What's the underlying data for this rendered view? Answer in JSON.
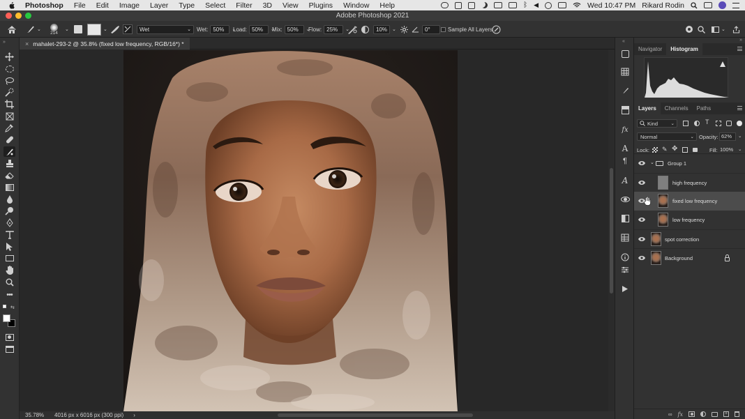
{
  "menubar": {
    "apple": "",
    "app": "Photoshop",
    "items": [
      "File",
      "Edit",
      "Image",
      "Layer",
      "Type",
      "Select",
      "Filter",
      "3D",
      "View",
      "Plugins",
      "Window",
      "Help"
    ],
    "clock": "Wed 10:47 PM",
    "user": "Rikard Rodin"
  },
  "window": {
    "title": "Adobe Photoshop 2021"
  },
  "options_bar": {
    "brush_size": "214",
    "mix_preset": "Wet",
    "wet_label": "Wet:",
    "wet_value": "50%",
    "load_label": "Load:",
    "load_value": "50%",
    "mix_label": "Mix:",
    "mix_value": "50%",
    "flow_label": "Flow:",
    "flow_value": "25%",
    "smoothing_value": "10%",
    "angle_value": "0°",
    "sample_all_layers": "Sample All Layers"
  },
  "document": {
    "tab_title": "mahalet-293-2 @ 35.8% (fixed low frequency, RGB/16*) *",
    "zoom": "35.78%",
    "dimensions": "4016 px x 6016 px (300 ppi)"
  },
  "navigator_panel": {
    "tabs": [
      "Navigator",
      "Histogram"
    ],
    "active_tab": "Histogram"
  },
  "layers_panel": {
    "tabs": [
      "Layers",
      "Channels",
      "Paths"
    ],
    "active_tab": "Layers",
    "filter_kind": "Kind",
    "blend_mode": "Normal",
    "opacity_label": "Opacity:",
    "opacity_value": "62%",
    "lock_label": "Lock:",
    "fill_label": "Fill:",
    "fill_value": "100%",
    "layers": [
      {
        "name": "Group 1",
        "type": "group",
        "visible": true,
        "selected": false
      },
      {
        "name": "high frequency",
        "type": "gray",
        "visible": true,
        "selected": false,
        "indented": true
      },
      {
        "name": "fixed low frequency",
        "type": "photo",
        "visible": true,
        "selected": true,
        "indented": true
      },
      {
        "name": "low frequency",
        "type": "photo",
        "visible": true,
        "selected": false,
        "indented": true
      },
      {
        "name": "spot correction",
        "type": "photo",
        "visible": true,
        "selected": false
      },
      {
        "name": "Background",
        "type": "photo",
        "visible": true,
        "selected": false,
        "locked": true
      }
    ]
  },
  "colors": {
    "panel_bg": "#323232",
    "canvas_bg": "#282828",
    "selected_layer": "#4c4c4c",
    "close": "#ff5f57",
    "minimize": "#febc2e",
    "zoom": "#28c840"
  }
}
